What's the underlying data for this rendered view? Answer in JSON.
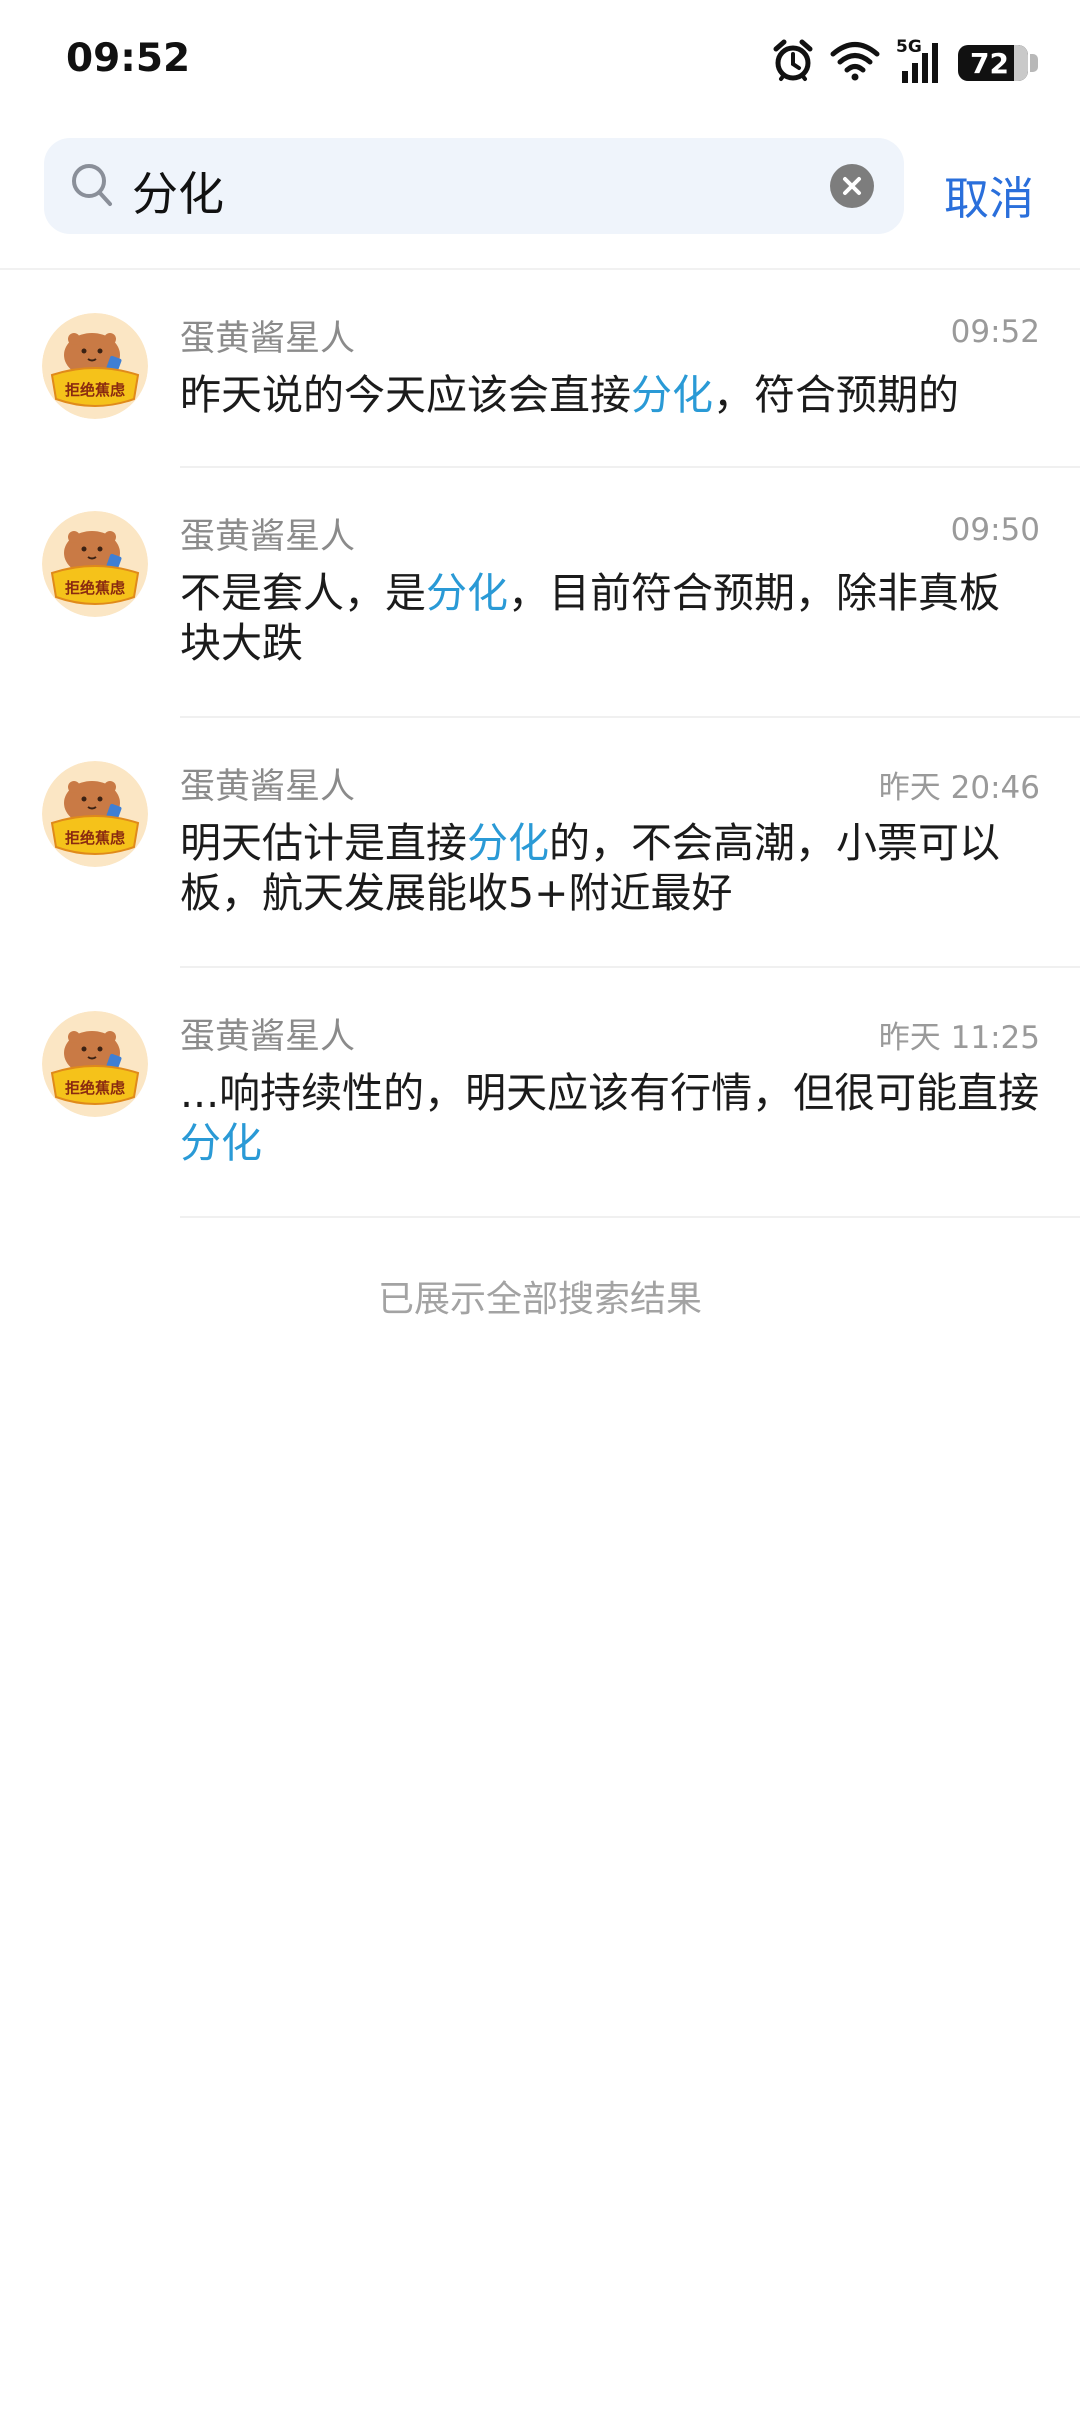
{
  "status_bar": {
    "time": "09:52",
    "network": "5G",
    "battery": "72",
    "icons": [
      "alarm-icon",
      "wifi-icon",
      "signal-icon",
      "battery-icon"
    ]
  },
  "search": {
    "query": "分化",
    "cancel_label": "取消"
  },
  "colors": {
    "accent": "#2a6fdb",
    "highlight": "#2a9ad6",
    "search_bg": "#eff4fb"
  },
  "results": [
    {
      "sender": "蛋黄酱星人",
      "time": "09:52",
      "parts": [
        "昨天说的今天应该会直接",
        "分化",
        "，符合预期的"
      ]
    },
    {
      "sender": "蛋黄酱星人",
      "time": "09:50",
      "parts": [
        "不是套人，是",
        "分化",
        "，目前符合预期，除非真板块大跌"
      ]
    },
    {
      "sender": "蛋黄酱星人",
      "time": "昨天 20:46",
      "parts": [
        "明天估计是直接",
        "分化",
        "的，不会高潮，小票可以板，航天发展能收5+附近最好"
      ]
    },
    {
      "sender": "蛋黄酱星人",
      "time": "昨天 11:25",
      "parts": [
        "...响持续性的，明天应该有行情，但很可能直接",
        "分化",
        ""
      ]
    }
  ],
  "end_note": "已展示全部搜索结果"
}
